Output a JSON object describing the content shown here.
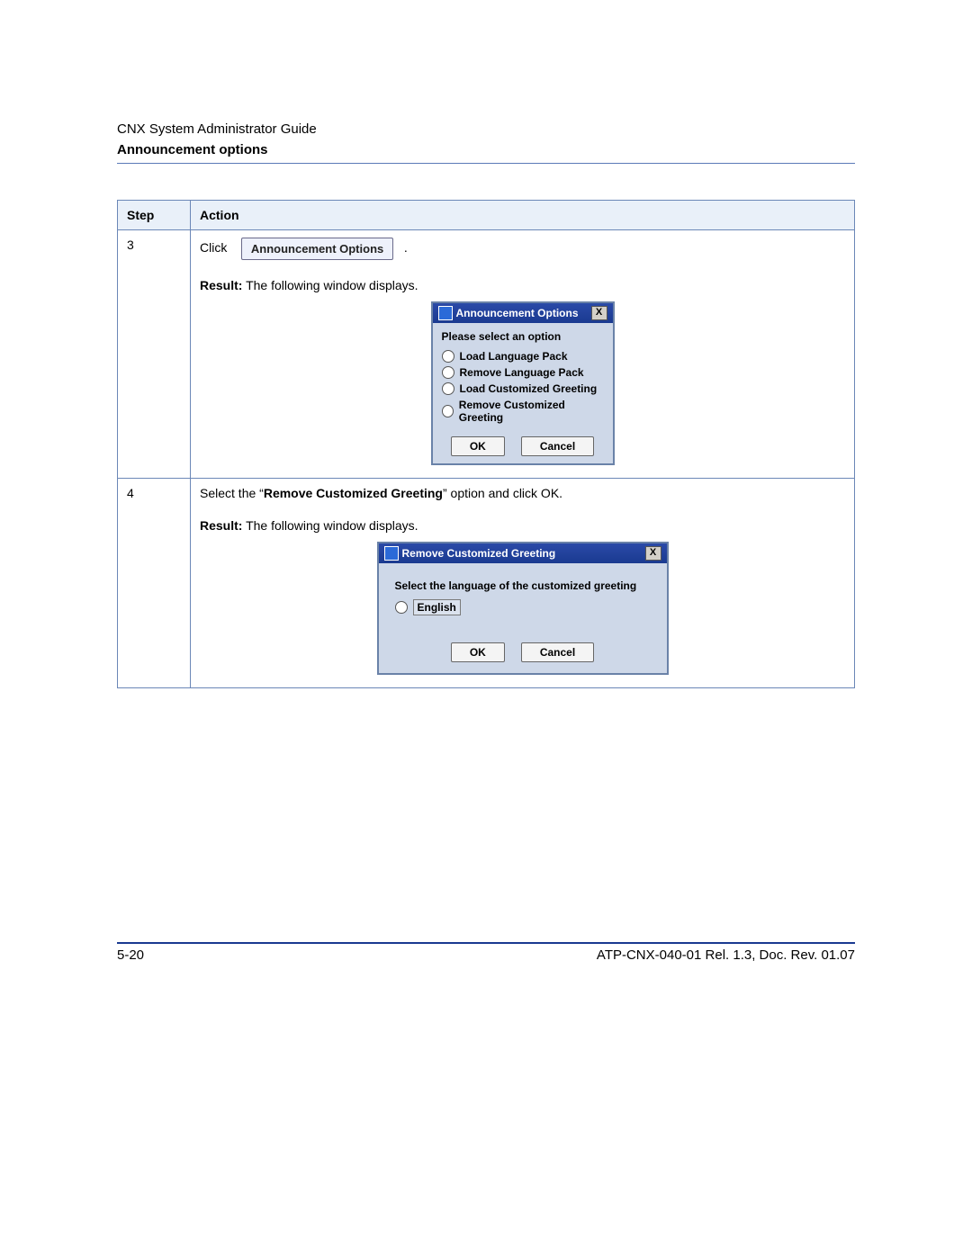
{
  "header": {
    "doc_title": "CNX System Administrator Guide",
    "section_title": "Announcement options"
  },
  "table": {
    "headers": {
      "step": "Step",
      "action": "Action"
    },
    "row3": {
      "step": "3",
      "click_word": "Click",
      "button_label": "Announcement Options",
      "dot": ".",
      "result_label": "Result:",
      "result_text": " The following window displays.",
      "dlg": {
        "title": "Announcement Options",
        "close": "X",
        "prompt": "Please select an option",
        "opt1": "Load Language Pack",
        "opt2": "Remove Language Pack",
        "opt3": "Load Customized Greeting",
        "opt4": "Remove Customized Greeting",
        "ok": "OK",
        "cancel": "Cancel"
      }
    },
    "row4": {
      "step": "4",
      "pre": "Select the “",
      "bold": "Remove Customized Greeting",
      "post": "” option and click OK.",
      "result_label": "Result:",
      "result_text": " The following window displays.",
      "dlg": {
        "title": "Remove Customized Greeting",
        "close": "X",
        "prompt": "Select the language of the customized greeting",
        "opt1": "English",
        "ok": "OK",
        "cancel": "Cancel"
      }
    }
  },
  "footer": {
    "page": "5-20",
    "doc_id": "ATP-CNX-040-01 Rel. 1.3, Doc. Rev. 01.07"
  }
}
